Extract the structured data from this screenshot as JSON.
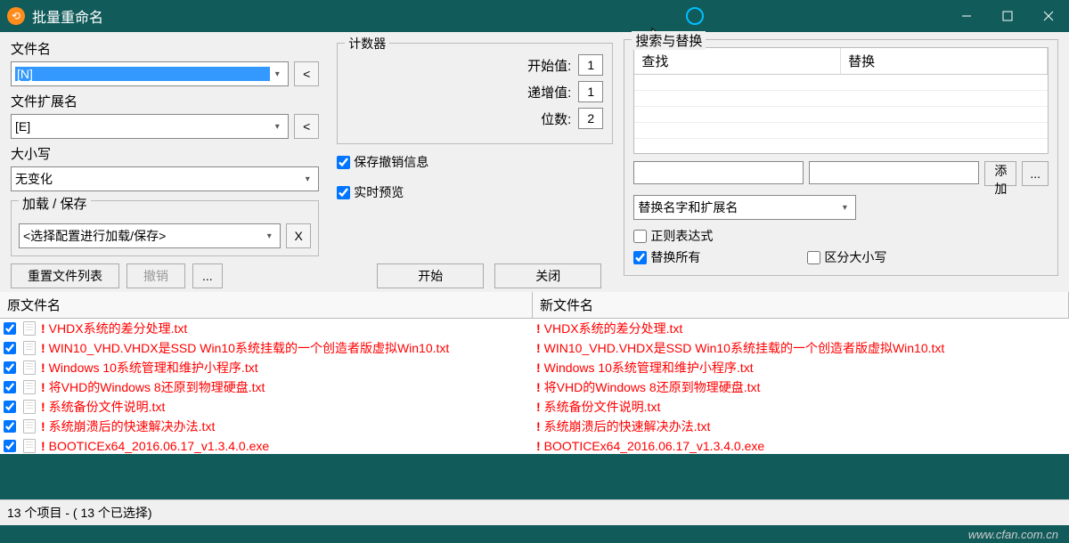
{
  "title": "批量重命名",
  "filename_label": "文件名",
  "filename_value": "[N]",
  "filename_clear": "<",
  "ext_label": "文件扩展名",
  "ext_value": "[E]",
  "ext_clear": "<",
  "case_label": "大小写",
  "case_value": "无变化",
  "loadsave_label": "加载 / 保存",
  "loadsave_value": "<选择配置进行加载/保存>",
  "loadsave_x": "X",
  "counter_label": "计数器",
  "counter_start_label": "开始值:",
  "counter_start": "1",
  "counter_step_label": "递增值:",
  "counter_step": "1",
  "counter_digits_label": "位数:",
  "counter_digits": "2",
  "chk_undo": "保存撤销信息",
  "chk_preview": "实时预览",
  "btn_reset": "重置文件列表",
  "btn_undo": "撤销",
  "btn_dots": "...",
  "btn_start": "开始",
  "btn_close": "关闭",
  "sr_label": "搜索与替换",
  "sr_find_hdr": "查找",
  "sr_replace_hdr": "替换",
  "sr_add": "添加",
  "sr_more": "...",
  "sr_scope": "替换名字和扩展名",
  "sr_regex": "正则表达式",
  "sr_replaceall": "替换所有",
  "sr_casesens": "区分大小写",
  "col_orig": "原文件名",
  "col_new": "新文件名",
  "files": [
    {
      "name": "VHDX系统的差分处理.txt",
      "new": "VHDX系统的差分处理.txt"
    },
    {
      "name": "WIN10_VHD.VHDX是SSD Win10系统挂载的一个创造者版虚拟Win10.txt",
      "new": "WIN10_VHD.VHDX是SSD Win10系统挂载的一个创造者版虚拟Win10.txt"
    },
    {
      "name": "Windows 10系统管理和维护小程序.txt",
      "new": "Windows 10系统管理和维护小程序.txt"
    },
    {
      "name": "将VHD的Windows 8还原到物理硬盘.txt",
      "new": "将VHD的Windows 8还原到物理硬盘.txt"
    },
    {
      "name": "系统备份文件说明.txt",
      "new": "系统备份文件说明.txt"
    },
    {
      "name": "系统崩溃后的快速解决办法.txt",
      "new": "系统崩溃后的快速解决办法.txt"
    },
    {
      "name": "BOOTICEx64_2016.06.17_v1.3.4.0.exe",
      "new": "BOOTICEx64_2016.06.17_v1.3.4.0.exe"
    }
  ],
  "status": "13 个项目 - ( 13 个已选择)",
  "watermark": "www.cfan.com.cn"
}
